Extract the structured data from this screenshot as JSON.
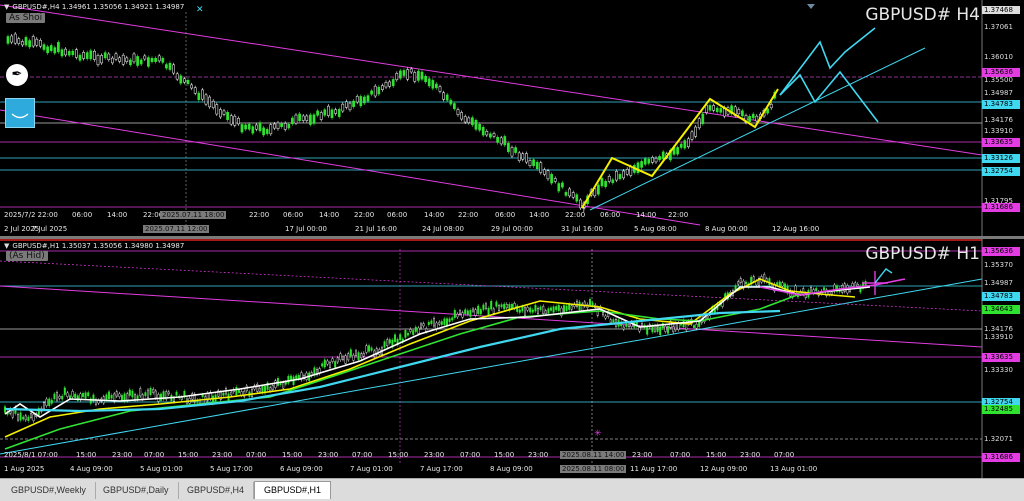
{
  "tabs": [
    "GBPUSD#,Weekly",
    "GBPUSD#,Daily",
    "GBPUSD#,H4",
    "GBPUSD#,H1"
  ],
  "active_tab": 3,
  "colors": {
    "magenta": "#e23ce2",
    "cyan": "#40d8f0",
    "yellow": "#f4f000",
    "green": "#31e331",
    "white": "#ffffff",
    "accent": "#e02020"
  },
  "h4": {
    "header": "GBPUSD#,H4  1.34961 1.35056 1.34921 1.34987",
    "big": "GBPUSD# H4",
    "badge": "As Shoi",
    "price_labels": [
      {
        "text": "1.37468",
        "style": "plain"
      },
      {
        "text": "1.37061",
        "style": "plain"
      },
      {
        "text": "1.36010",
        "style": "plain"
      },
      {
        "text": "1.35636",
        "style": "magenta"
      },
      {
        "text": "1.35500",
        "style": "plain"
      },
      {
        "text": "1.34987",
        "style": "plain"
      },
      {
        "text": "1.34783",
        "style": "cyan"
      },
      {
        "text": "1.34176",
        "style": "plain"
      },
      {
        "text": "1.33910",
        "style": "plain"
      },
      {
        "text": "1.33635",
        "style": "magenta"
      },
      {
        "text": "1.33126",
        "style": "cyan"
      },
      {
        "text": "1.32754",
        "style": "cyan"
      },
      {
        "text": "1.31795",
        "style": "plain"
      },
      {
        "text": "1.31686",
        "style": "magenta"
      }
    ],
    "time_labels": [
      "2 Jul 2025",
      "7 Jul 2025",
      "2025.07.11 12:00",
      "17 Jul 00:00",
      "21 Jul 16:00",
      "24 Jul 08:00",
      "29 Jul 00:00",
      "31 Jul 16:00",
      "5 Aug 08:00",
      "8 Aug 00:00",
      "12 Aug 16:00"
    ],
    "time_labels2": [
      "2025/7/2 22:00",
      "06:00",
      "14:00",
      "22:00",
      "2025.07.11 18:00",
      "22:00",
      "06:00",
      "14:00",
      "22:00",
      "06:00",
      "14:00",
      "22:00",
      "06:00",
      "14:00",
      "22:00",
      "06:00",
      "14:00",
      "22:00"
    ]
  },
  "h1": {
    "header": "GBPUSD#,H1  1.35037 1.35056 1.34980 1.34987",
    "big": "GBPUSD# H1",
    "badge": "(As Hid)",
    "price_labels": [
      {
        "text": "1.35636",
        "style": "magenta"
      },
      {
        "text": "1.35370",
        "style": "plain"
      },
      {
        "text": "1.34987",
        "style": "plain"
      },
      {
        "text": "1.34783",
        "style": "cyan"
      },
      {
        "text": "1.34643",
        "style": "green"
      },
      {
        "text": "1.34176",
        "style": "plain"
      },
      {
        "text": "1.33910",
        "style": "plain"
      },
      {
        "text": "1.33635",
        "style": "magenta"
      },
      {
        "text": "1.33330",
        "style": "plain"
      },
      {
        "text": "1.32754",
        "style": "cyan"
      },
      {
        "text": "1.32485",
        "style": "green"
      },
      {
        "text": "1.32071",
        "style": "plain"
      },
      {
        "text": "1.31686",
        "style": "magenta"
      }
    ],
    "time_labels": [
      "1 Aug 2025",
      "4 Aug 09:00",
      "5 Aug 01:00",
      "5 Aug 17:00",
      "6 Aug 09:00",
      "7 Aug 01:00",
      "7 Aug 17:00",
      "8 Aug 09:00",
      "2025.08.11 08:00",
      "11 Aug 17:00",
      "12 Aug 09:00",
      "13 Aug 01:00"
    ],
    "time_labels2": [
      "2025/8/1 07:00",
      "15:00",
      "23:00",
      "07:00",
      "15:00",
      "23:00",
      "07:00",
      "15:00",
      "23:00",
      "07:00",
      "15:00",
      "23:00",
      "07:00",
      "15:00",
      "23:00",
      "2025.08.11 14:00",
      "23:00",
      "07:00",
      "15:00",
      "23:00",
      "07:00"
    ]
  }
}
